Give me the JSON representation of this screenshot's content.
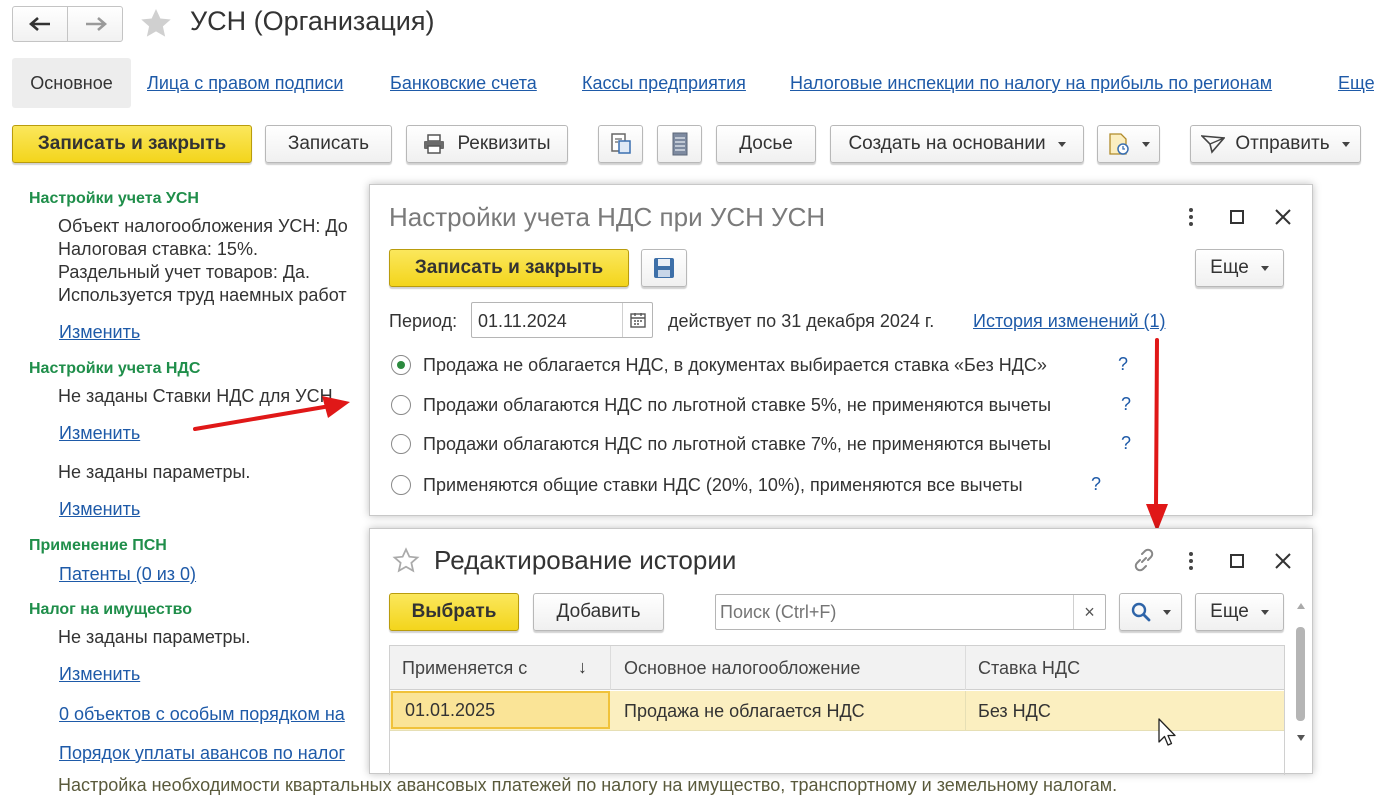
{
  "window": {
    "title": "УСН (Организация)"
  },
  "tabs": {
    "active": "Основное",
    "links": [
      "Лица с правом подписи",
      "Банковские счета",
      "Кассы предприятия",
      "Налоговые инспекции по налогу на прибыль по регионам",
      "Еще"
    ]
  },
  "toolbar": {
    "save_close": "Записать и закрыть",
    "save": "Записать",
    "requisites": "Реквизиты",
    "dossier": "Досье",
    "create_based": "Создать на основании",
    "send": "Отправить"
  },
  "left": {
    "usn_title": "Настройки учета УСН",
    "usn_lines": [
      "Объект налогообложения УСН: До",
      "Налоговая ставка: 15%.",
      "Раздельный учет товаров: Да.",
      "Используется труд наемных работ"
    ],
    "change": "Изменить",
    "vat_title": "Настройки учета НДС",
    "vat_line": "Не заданы Ставки НДС для УСН.",
    "params_line": "Не заданы параметры.",
    "psn_title": "Применение ПСН",
    "patents": "Патенты (0 из 0)",
    "property_title": "Налог на имущество",
    "property_line": "Не заданы параметры.",
    "objects_link": "0 объектов с особым порядком на",
    "advances_link": "Порядок уплаты авансов по налог",
    "footer_note": "Настройка необходимости квартальных авансовых платежей по налогу на имущество, транспортному и земельному налогам."
  },
  "vat_dialog": {
    "title": "Настройки учета НДС при УСН УСН",
    "save_close": "Записать и закрыть",
    "more": "Еще",
    "period_label": "Период:",
    "period_value": "01.11.2024",
    "effective_text": "действует по 31 декабря 2024 г.",
    "history_link": "История изменений (1)",
    "options": [
      "Продажа не облагается НДС, в документах выбирается ставка «Без НДС»",
      "Продажи облагаются НДС по льготной ставке 5%, не применяются вычеты",
      "Продажи облагаются НДС по льготной ставке 7%, не применяются вычеты",
      "Применяются общие ставки НДС (20%, 10%), применяются все вычеты"
    ],
    "selected_index": 0,
    "help": "?"
  },
  "history_dialog": {
    "title": "Редактирование истории",
    "select": "Выбрать",
    "add": "Добавить",
    "search_placeholder": "Поиск (Ctrl+F)",
    "clear": "×",
    "more": "Еще",
    "columns": [
      "Применяется с",
      "Основное налогообложение",
      "Ставка НДС"
    ],
    "sort_arrow": "↓",
    "rows": [
      {
        "date": "01.01.2025",
        "tax": "Продажа не облагается НДС",
        "vat": "Без НДС"
      }
    ]
  },
  "colors": {
    "accent_yellow": "#f5d92a",
    "link": "#1e5aa8",
    "section_green": "#1f8e4a",
    "arrow_red": "#e01818"
  }
}
